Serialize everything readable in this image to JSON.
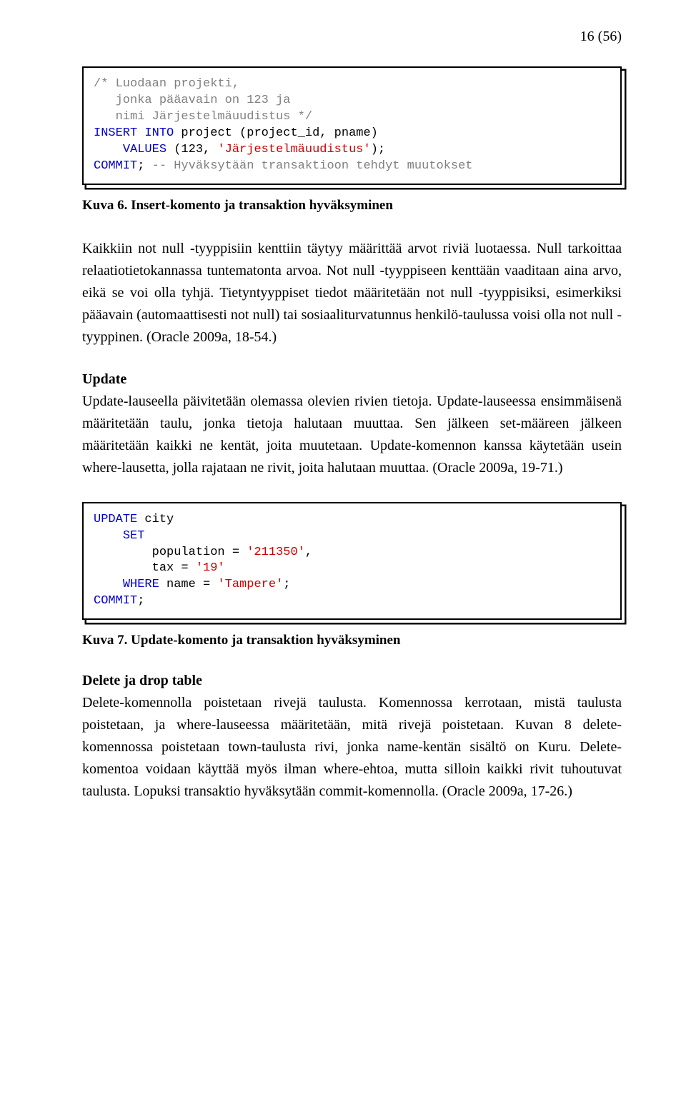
{
  "page_number": "16 (56)",
  "code1": {
    "c1": "/* Luodaan projekti,",
    "c2": "   jonka pääavain on 123 ja",
    "c3": "   nimi Järjestelmäuudistus */",
    "k_insert": "INSERT",
    "k_into": "INTO",
    "t_project": " project (project_id, pname)",
    "k_values": "VALUES",
    "t_vals": " (123, ",
    "s_val": "'Järjestelmäuudistus'",
    "t_close": ");",
    "k_commit": "COMMIT",
    "t_semi": ";",
    "c_end": " -- Hyväksytään transaktioon tehdyt muutokset"
  },
  "caption1": "Kuva 6. Insert-komento ja transaktion hyväksyminen",
  "para1": "Kaikkiin not null -tyyppisiin kenttiin täytyy määrittää arvot riviä luotaessa. Null tarkoittaa relaatiotietokannassa tuntematonta arvoa. Not null -tyyppiseen kenttään vaaditaan aina arvo, eikä se voi olla tyhjä. Tietyntyyppiset tiedot määritetään not null -tyyppisiksi, esimerkiksi pääavain (automaattisesti not null) tai sosiaaliturvatunnus henkilö-taulussa voisi olla not null -tyyppinen. (Oracle 2009a, 18-54.)",
  "head_update": "Update",
  "para2": "Update-lauseella päivitetään olemassa olevien rivien tietoja. Update-lauseessa ensimmäisenä määritetään taulu, jonka tietoja halutaan muuttaa. Sen jälkeen set-määreen jälkeen määritetään kaikki ne kentät, joita muutetaan. Update-komennon kanssa käytetään usein where-lausetta, jolla rajataan ne rivit, joita halutaan muuttaa. (Oracle 2009a, 19-71.)",
  "code2": {
    "k_update": "UPDATE",
    "t_city": " city",
    "k_set": "SET",
    "t_pop": "        population = ",
    "s_pop": "'211350'",
    "t_comma": ",",
    "t_tax": "        tax = ",
    "s_tax": "'19'",
    "k_where": "WHERE",
    "t_name": " name = ",
    "s_name": "'Tampere'",
    "t_semi": ";",
    "k_commit": "COMMIT",
    "t_semi2": ";"
  },
  "caption2": "Kuva 7. Update-komento ja transaktion hyväksyminen",
  "head_delete": "Delete ja drop table",
  "para3": "Delete-komennolla poistetaan rivejä taulusta. Komennossa kerrotaan, mistä taulusta poistetaan, ja where-lauseessa määritetään, mitä rivejä poistetaan. Kuvan 8 delete-komennossa poistetaan town-taulusta rivi, jonka name-kentän sisältö on Kuru. Delete-komentoa voidaan käyttää myös ilman where-ehtoa, mutta silloin kaikki rivit tuhoutuvat taulusta. Lopuksi transaktio hyväksytään commit-komennolla. (Oracle 2009a, 17-26.)"
}
